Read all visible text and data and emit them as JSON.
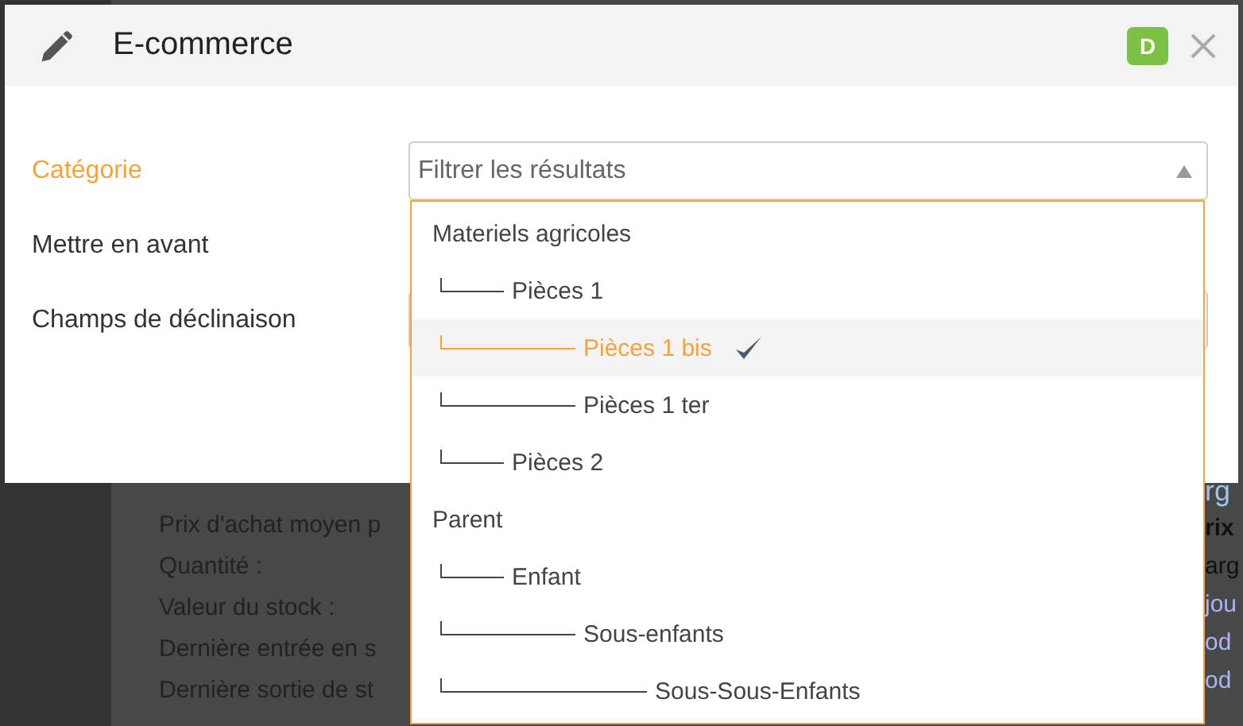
{
  "background_page": {
    "left_lines": [
      {
        "text": "Prix d'achat moyen p"
      },
      {
        "text": "Quantité :"
      },
      {
        "text": "Valeur du stock :"
      },
      {
        "text": "Dernière entrée en s"
      },
      {
        "text": "Dernière sortie de st"
      }
    ],
    "right_lines": [
      {
        "text": "rg",
        "kind": "heading"
      },
      {
        "text": "rix",
        "kind": "bold"
      },
      {
        "text": "arg",
        "kind": "plain"
      },
      {
        "text": "jou",
        "kind": "link"
      },
      {
        "text": "od",
        "kind": "link"
      },
      {
        "text": "od",
        "kind": "link"
      }
    ]
  },
  "modal": {
    "title": "E-commerce",
    "badge": "D",
    "fields": [
      {
        "label": "Catégorie",
        "active": true,
        "placeholder": "Filtrer les résultats"
      },
      {
        "label": "Mettre en avant",
        "active": false
      },
      {
        "label": "Champs de déclinaison",
        "active": false
      }
    ],
    "dropdown": {
      "items": [
        {
          "label": "Materiels agricoles",
          "selected": false,
          "children": [
            {
              "label": "Pièces 1",
              "selected": false,
              "children": [
                {
                  "label": "Pièces 1 bis",
                  "selected": true
                },
                {
                  "label": "Pièces 1 ter",
                  "selected": false
                }
              ]
            },
            {
              "label": "Pièces 2",
              "selected": false
            }
          ]
        },
        {
          "label": "Parent",
          "selected": false,
          "children": [
            {
              "label": "Enfant",
              "selected": false,
              "children": [
                {
                  "label": "Sous-enfants",
                  "selected": false,
                  "children": [
                    {
                      "label": "Sous-Sous-Enfants",
                      "selected": false
                    }
                  ]
                }
              ]
            }
          ]
        }
      ]
    }
  }
}
